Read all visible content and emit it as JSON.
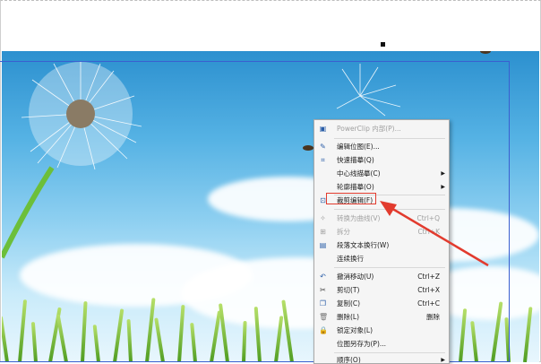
{
  "canvas": {
    "accent": "#3a5fd0"
  },
  "context_menu": {
    "items": [
      {
        "icon": "powerclip-icon",
        "label": "PowerClip 内部(P)...",
        "shortcut": "",
        "submenu": false,
        "disabled": true
      },
      {
        "icon": "edit-bitmap-icon",
        "label": "编辑位图(E)...",
        "shortcut": "",
        "submenu": false,
        "disabled": false
      },
      {
        "icon": "quick-trace-icon",
        "label": "快速描摹(Q)",
        "shortcut": "",
        "submenu": false,
        "disabled": false
      },
      {
        "icon": "",
        "label": "中心线描摹(C)",
        "shortcut": "",
        "submenu": true,
        "disabled": false
      },
      {
        "icon": "",
        "label": "轮廓描摹(O)",
        "shortcut": "",
        "submenu": true,
        "disabled": false
      },
      {
        "icon": "crop-edit-icon",
        "label": "裁剪编辑(F)",
        "shortcut": "",
        "submenu": false,
        "disabled": false
      },
      {
        "icon": "convert-curve-icon",
        "label": "转换为曲线(V)",
        "shortcut": "Ctrl+Q",
        "submenu": false,
        "disabled": true
      },
      {
        "icon": "split-icon",
        "label": "拆分",
        "shortcut": "Ctrl+K",
        "submenu": false,
        "disabled": true
      },
      {
        "icon": "paragraph-wrap-icon",
        "label": "段落文本换行(W)",
        "shortcut": "",
        "submenu": false,
        "disabled": false
      },
      {
        "icon": "",
        "label": "连续换行",
        "shortcut": "",
        "submenu": false,
        "disabled": false
      },
      {
        "icon": "undo-icon",
        "label": "撤消移动(U)",
        "shortcut": "Ctrl+Z",
        "submenu": false,
        "disabled": false
      },
      {
        "icon": "cut-icon",
        "label": "剪切(T)",
        "shortcut": "Ctrl+X",
        "submenu": false,
        "disabled": false
      },
      {
        "icon": "copy-icon",
        "label": "复制(C)",
        "shortcut": "Ctrl+C",
        "submenu": false,
        "disabled": false
      },
      {
        "icon": "delete-icon",
        "label": "删除(L)",
        "shortcut": "删除",
        "submenu": false,
        "disabled": false
      },
      {
        "icon": "lock-icon",
        "label": "锁定对象(L)",
        "shortcut": "",
        "submenu": false,
        "disabled": false
      },
      {
        "icon": "",
        "label": "位图另存为(P)...",
        "shortcut": "",
        "submenu": false,
        "disabled": false
      },
      {
        "icon": "",
        "label": "顺序(O)",
        "shortcut": "",
        "submenu": true,
        "disabled": false
      }
    ]
  },
  "annotation": {
    "color": "#e23b2e"
  }
}
